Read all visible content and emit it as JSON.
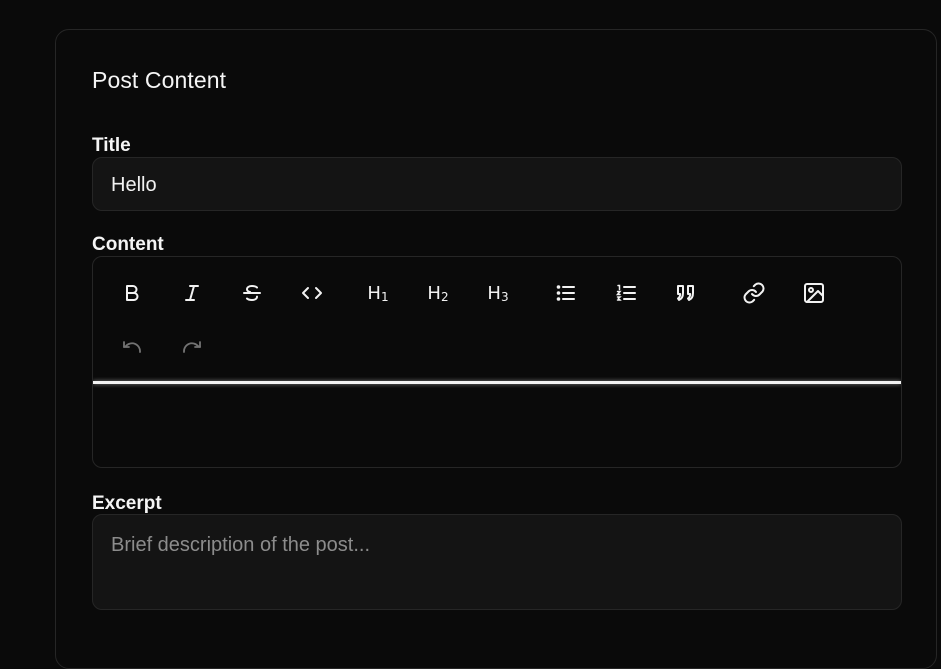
{
  "card": {
    "title": "Post Content"
  },
  "fields": {
    "title_label": "Title",
    "title_value": "Hello",
    "content_label": "Content",
    "excerpt_label": "Excerpt",
    "excerpt_placeholder": "Brief description of the post..."
  },
  "toolbar": {
    "h1": "H",
    "h1_sub": "1",
    "h2": "H",
    "h2_sub": "2",
    "h3": "H",
    "h3_sub": "3",
    "icons": [
      "bold-icon",
      "italic-icon",
      "strikethrough-icon",
      "code-icon",
      "heading-1-icon",
      "heading-2-icon",
      "heading-3-icon",
      "bullet-list-icon",
      "ordered-list-icon",
      "quote-icon",
      "link-icon",
      "image-icon",
      "undo-icon",
      "redo-icon"
    ]
  },
  "colors": {
    "background": "#0a0a0a",
    "input_background": "#141414",
    "border": "#262626",
    "text": "#f2f2f2",
    "placeholder": "#8c8c8c",
    "disabled_icon": "#737373"
  }
}
